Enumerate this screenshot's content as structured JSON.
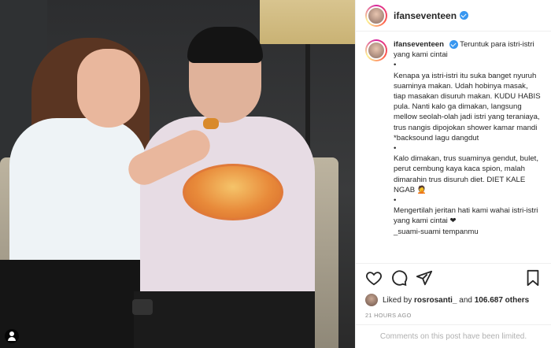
{
  "post": {
    "username": "ifanseventeen",
    "caption_user": "ifanseventeen",
    "caption_text": "Teruntuk para istri-istri yang kami cintai\n•\nKenapa ya istri-istri itu suka banget nyuruh suaminya makan. Udah hobinya masak, tiap masakan disuruh makan. KUDU HABIS pula. Nanti kalo ga dimakan, langsung mellow seolah-olah jadi istri yang teraniaya, trus nangis dipojokan shower kamar mandi *backsound lagu dangdut\n•\nKalo dimakan, trus suaminya gendut, bulet, perut cembung kaya kaca spion, malah dimarahin trus disuruh diet. DIET KALE NGAB 🤦\n•\nMengertilah jeritan hati kami wahai istri-istri yang kami cintai ❤\n_suami-suami tempanmu",
    "liked_by_prefix": "Liked by",
    "liked_by_user": "rosrosanti_",
    "liked_and": "and",
    "likes_count": "106.687 others",
    "timestamp": "21 HOURS AGO",
    "comments_notice": "Comments on this post have been limited."
  },
  "icons": {
    "verified": "verified-badge-icon",
    "like": "heart-icon",
    "comment": "comment-icon",
    "share": "send-icon",
    "save": "bookmark-icon",
    "tag": "user-tag-icon"
  },
  "colors": {
    "verified": "#3897f0",
    "muted": "#8e8e8e",
    "text": "#262626",
    "border": "#efefef"
  }
}
